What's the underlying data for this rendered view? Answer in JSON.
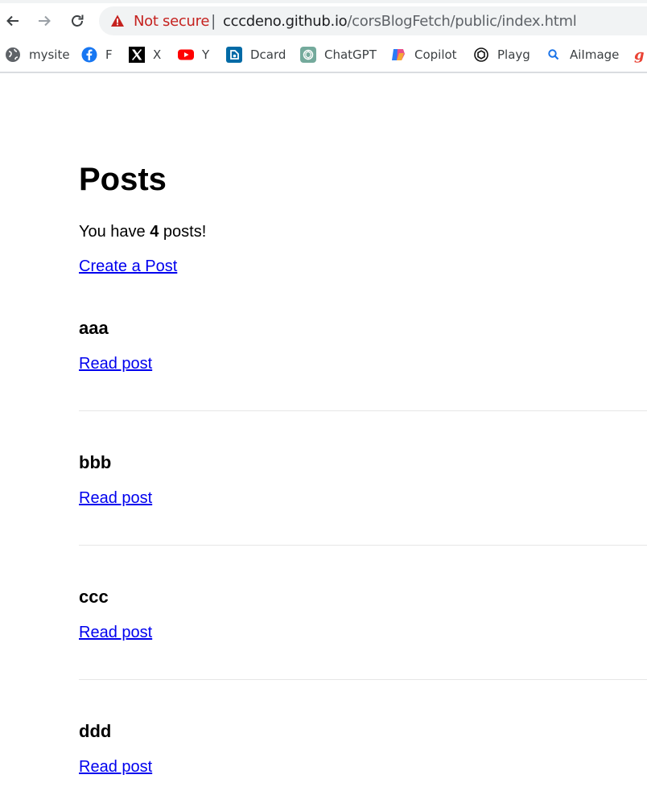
{
  "browser": {
    "security_label": "Not secure",
    "separator": "|",
    "url_host": "cccdeno.github.io",
    "url_path": "/corsBlogFetch/public/index.html"
  },
  "bookmarks": [
    {
      "label": "mysite",
      "icon": "globe-icon"
    },
    {
      "label": "F",
      "icon": "facebook-icon"
    },
    {
      "label": "X",
      "icon": "x-icon"
    },
    {
      "label": "Y",
      "icon": "youtube-icon"
    },
    {
      "label": "Dcard",
      "icon": "dcard-icon"
    },
    {
      "label": "ChatGPT",
      "icon": "chatgpt-icon"
    },
    {
      "label": "Copilot",
      "icon": "copilot-icon"
    },
    {
      "label": "Playg",
      "icon": "openai-icon"
    },
    {
      "label": "AiImage",
      "icon": "search-icon"
    }
  ],
  "page": {
    "title": "Posts",
    "count_prefix": "You have ",
    "count": "4",
    "count_suffix": " posts!",
    "create_link": "Create a Post",
    "posts": [
      {
        "title": "aaa",
        "link": "Read post"
      },
      {
        "title": "bbb",
        "link": "Read post"
      },
      {
        "title": "ccc",
        "link": "Read post"
      },
      {
        "title": "ddd",
        "link": "Read post"
      }
    ]
  },
  "colors": {
    "link": "#0000ee",
    "warning": "#c5221f"
  }
}
